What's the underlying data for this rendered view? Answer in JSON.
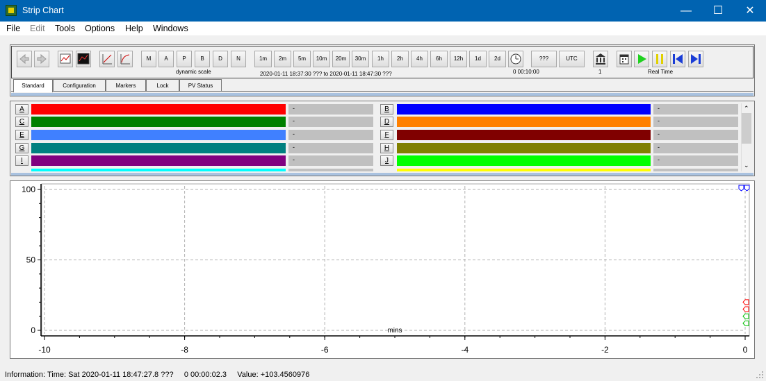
{
  "window": {
    "title": "Strip Chart",
    "min_glyph": "—",
    "max_glyph": "☐",
    "close_glyph": "✕"
  },
  "menu": [
    "File",
    "Edit",
    "Tools",
    "Options",
    "Help",
    "Windows"
  ],
  "toolbar": {
    "scale_buttons": [
      "M",
      "A",
      "P",
      "B",
      "D",
      "N"
    ],
    "scale_label": "dynamic scale",
    "time_buttons": [
      "1m",
      "2m",
      "5m",
      "10m",
      "20m",
      "30m",
      "1h",
      "2h",
      "4h",
      "6h",
      "12h",
      "1d",
      "2d"
    ],
    "time_range": "2020-01-11 18:37:30 ??? to 2020-01-11 18:47:30 ???",
    "span_label": "0 00:10:00",
    "tz_button": "???",
    "utc_button": "UTC",
    "archive_count": "1",
    "realtime_label": "Real Time"
  },
  "tabs": [
    "Standard",
    "Configuration",
    "Markers",
    "Lock",
    "PV Status"
  ],
  "pvs": [
    {
      "letter": "A",
      "color": "#ff0000",
      "value": "-"
    },
    {
      "letter": "B",
      "color": "#0000ff",
      "value": "-"
    },
    {
      "letter": "C",
      "color": "#008000",
      "value": "-"
    },
    {
      "letter": "D",
      "color": "#ff8000",
      "value": "-"
    },
    {
      "letter": "E",
      "color": "#4080ff",
      "value": "-"
    },
    {
      "letter": "F",
      "color": "#800000",
      "value": "-"
    },
    {
      "letter": "G",
      "color": "#008080",
      "value": "-"
    },
    {
      "letter": "H",
      "color": "#808000",
      "value": "-"
    },
    {
      "letter": "I",
      "color": "#800080",
      "value": "-"
    },
    {
      "letter": "J",
      "color": "#00ff00",
      "value": "-"
    },
    {
      "letter": "",
      "color": "#00ffff",
      "value": ""
    },
    {
      "letter": "",
      "color": "#ffff00",
      "value": ""
    }
  ],
  "chart_data": {
    "type": "line",
    "xlabel": "mins",
    "xlim": [
      -10,
      0
    ],
    "ylim": [
      0,
      100
    ],
    "x_ticks": [
      "-10",
      "-8",
      "-6",
      "-4",
      "-2",
      "0"
    ],
    "y_ticks": [
      "100",
      "50",
      "0"
    ],
    "grid": true,
    "series": [],
    "markers_right_edge": [
      {
        "y": 100,
        "color": "#0000ff"
      },
      {
        "y": 100,
        "color": "#0000ff"
      },
      {
        "y": 20,
        "color": "#ff0000"
      },
      {
        "y": 15,
        "color": "#ff0000"
      },
      {
        "y": 10,
        "color": "#00c000"
      },
      {
        "y": 5,
        "color": "#00c000"
      }
    ]
  },
  "status": {
    "text": "Information: Time: Sat 2020-01-11 18:47:27.8 ???     0 00:00:02.3     Value: +103.4560976"
  }
}
